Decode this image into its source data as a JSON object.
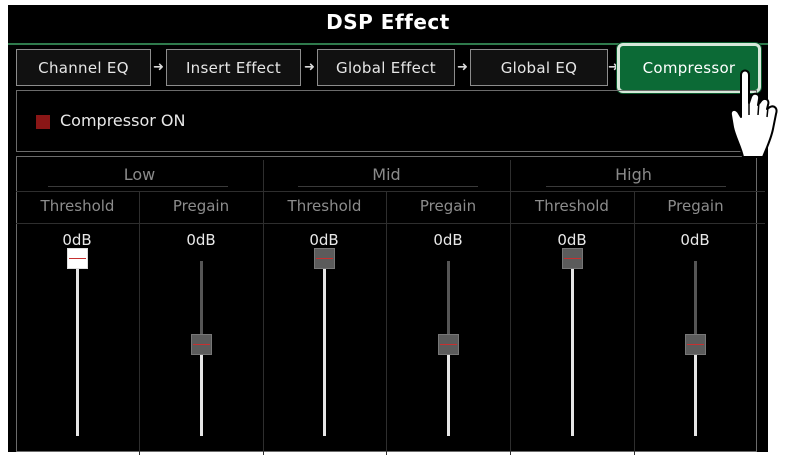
{
  "title": "DSP Effect",
  "tabs": [
    {
      "label": "Channel EQ",
      "active": false
    },
    {
      "label": "Insert Effect",
      "active": false
    },
    {
      "label": "Global Effect",
      "active": false
    },
    {
      "label": "Global EQ",
      "active": false
    },
    {
      "label": "Compressor",
      "active": true
    }
  ],
  "compressor_switch": {
    "label": "Compressor ON",
    "checked": false
  },
  "bands": [
    {
      "name": "Low",
      "columns": [
        {
          "label": "Threshold",
          "value": "0dB",
          "level": 1.0,
          "selected": true
        },
        {
          "label": "Pregain",
          "value": "0dB",
          "level": 0.5,
          "selected": false
        }
      ]
    },
    {
      "name": "Mid",
      "columns": [
        {
          "label": "Threshold",
          "value": "0dB",
          "level": 1.0,
          "selected": false
        },
        {
          "label": "Pregain",
          "value": "0dB",
          "level": 0.5,
          "selected": false
        }
      ]
    },
    {
      "name": "High",
      "columns": [
        {
          "label": "Threshold",
          "value": "0dB",
          "level": 1.0,
          "selected": false
        },
        {
          "label": "Pregain",
          "value": "0dB",
          "level": 0.5,
          "selected": false
        }
      ]
    }
  ],
  "colors": {
    "accent": "#0c6a36",
    "marker": "#c63030",
    "switch_box": "#8a1616"
  },
  "icons": {
    "tab_arrow": "right-arrow-icon",
    "pointer": "pointing-hand-icon"
  }
}
